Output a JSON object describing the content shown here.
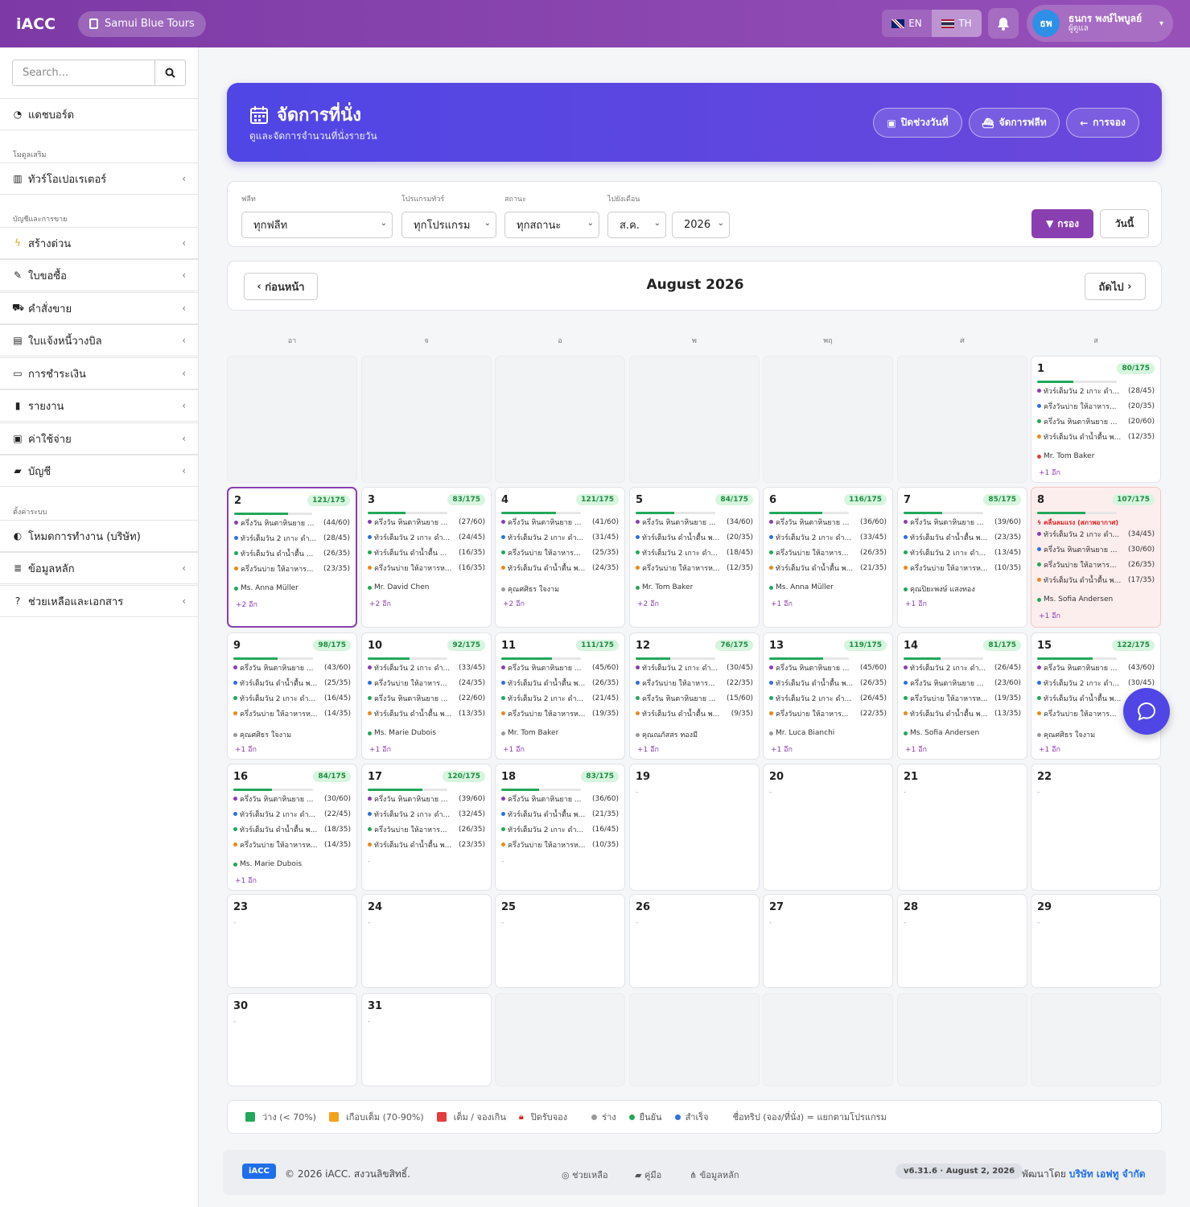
{
  "topbar": {
    "brand": "iACC",
    "company": "Samui Blue Tours",
    "lang_en": "EN",
    "lang_th": "TH",
    "user_initials": "ธพ",
    "user_name": "ธนกร พงษ์ไพบูลย์",
    "user_role": "ผู้ดูแล"
  },
  "sidebar": {
    "search_placeholder": "Search...",
    "dashboard": "แดชบอร์ด",
    "sect_modules": "โมดูลเสริม",
    "tour_operator": "ทัวร์โอเปอเรเตอร์",
    "sect_sales": "บัญชีและการขาย",
    "quick_create": "สร้างด่วน",
    "po": "ใบขอซื้อ",
    "sales_order": "คำสั่งขาย",
    "invoice": "ใบแจ้งหนี้วางบิล",
    "payment": "การชำระเงิน",
    "report": "รายงาน",
    "expense": "ค่าใช้จ่าย",
    "account": "บัญชี",
    "sect_settings": "ตั้งค่าระบบ",
    "work_mode": "โหมดการทำงาน (บริษัท)",
    "master_data": "ข้อมูลหลัก",
    "help": "ช่วยเหลือและเอกสาร"
  },
  "hero": {
    "title": "จัดการที่นั่ง",
    "subtitle": "ดูและจัดการจำนวนที่นั่งรายวัน",
    "btn_close": "ปิดช่วงวันที่",
    "btn_fleet": "จัดการฟลีท",
    "btn_back": "การจอง"
  },
  "filters": {
    "fleet_label": "ฟลีท",
    "fleet_value": "ทุกฟลีท",
    "program_label": "โปรแกรมทัวร์",
    "program_value": "ทุกโปรแกรม",
    "status_label": "สถานะ",
    "status_value": "ทุกสถานะ",
    "month_label": "ไปยังเดือน",
    "month_value": "ส.ค.",
    "year_value": "2026",
    "filter_btn": "กรอง",
    "today_btn": "วันนี้"
  },
  "month": {
    "prev": "ก่อนหน้า",
    "title": "August 2026",
    "next": "ถัดไป"
  },
  "weekdays": [
    "อา",
    "จ",
    "อ",
    "พ",
    "พฤ",
    "ศ",
    "ส"
  ],
  "colors": {
    "purple": "#8a3fb0",
    "status_pending": "#8a3fb0",
    "status_confirmed": "#22a85a",
    "status_done": "#2f6fe0",
    "orange": "#e88a1a"
  },
  "days": [
    {
      "d": "1",
      "badge": "80/175",
      "pct": 0.457,
      "rows": [
        [
          "ทัวร์เต็มวัน 2 เกาะ ดำ...",
          "(28/45)",
          "#8a3fb0"
        ],
        [
          "ครึ่งวันบ่าย ให้อาหาร...",
          "(20/35)",
          "#2f6fe0"
        ],
        [
          "ครึ่งวัน หินตาหินยาย ...",
          "(20/60)",
          "#22a85a"
        ],
        [
          "ทัวร์เต็มวัน ดำน้ำตื้น พ...",
          "(12/35)",
          "#e88a1a"
        ]
      ],
      "guest": "Mr. Tom Baker",
      "gc": "#e04040",
      "more": "+1 อีก"
    },
    {
      "d": "2",
      "badge": "121/175",
      "pct": 0.691,
      "rows": [
        [
          "ครึ่งวัน หินตาหินยาย ...",
          "(44/60)",
          "#8a3fb0"
        ],
        [
          "ทัวร์เต็มวัน 2 เกาะ ดำ...",
          "(28/45)",
          "#2f6fe0"
        ],
        [
          "ทัวร์เต็มวัน ดำน้ำตื้น ...",
          "(26/35)",
          "#22a85a"
        ],
        [
          "ครึ่งวันบ่าย ให้อาหาร...",
          "(23/35)",
          "#e88a1a"
        ]
      ],
      "guest": "Ms. Anna Müller",
      "gc": "#22a85a",
      "more": "+2 อีก"
    },
    {
      "d": "3",
      "badge": "83/175",
      "pct": 0.474,
      "rows": [
        [
          "ครึ่งวัน หินตาหินยาย ...",
          "(27/60)",
          "#8a3fb0"
        ],
        [
          "ทัวร์เต็มวัน 2 เกาะ ดำ...",
          "(24/45)",
          "#2f6fe0"
        ],
        [
          "ทัวร์เต็มวัน ดำน้ำตื้น ...",
          "(16/35)",
          "#22a85a"
        ],
        [
          "ครึ่งวันบ่าย ให้อาหารห...",
          "(16/35)",
          "#e88a1a"
        ]
      ],
      "guest": "Mr. David Chen",
      "gc": "#22a85a",
      "more": "+2 อีก"
    },
    {
      "d": "4",
      "badge": "121/175",
      "pct": 0.691,
      "rows": [
        [
          "ครึ่งวัน หินตาหินยาย ...",
          "(41/60)",
          "#8a3fb0"
        ],
        [
          "ทัวร์เต็มวัน 2 เกาะ ดำ...",
          "(31/45)",
          "#2f6fe0"
        ],
        [
          "ครึ่งวันบ่าย ให้อาหาร...",
          "(25/35)",
          "#22a85a"
        ],
        [
          "ทัวร์เต็มวัน ดำน้ำตื้น พ...",
          "(24/35)",
          "#e88a1a"
        ]
      ],
      "guest": "คุณศศิธร ใจงาม",
      "gc": "#999999",
      "more": "+2 อีก"
    },
    {
      "d": "5",
      "badge": "84/175",
      "pct": 0.48,
      "rows": [
        [
          "ครึ่งวัน หินตาหินยาย ...",
          "(34/60)",
          "#8a3fb0"
        ],
        [
          "ทัวร์เต็มวัน ดำน้ำตื้น พ...",
          "(20/35)",
          "#2f6fe0"
        ],
        [
          "ทัวร์เต็มวัน 2 เกาะ ดำ...",
          "(18/45)",
          "#22a85a"
        ],
        [
          "ครึ่งวันบ่าย ให้อาหารห...",
          "(12/35)",
          "#e88a1a"
        ]
      ],
      "guest": "Mr. Tom Baker",
      "gc": "#22a85a",
      "more": "+2 อีก"
    },
    {
      "d": "6",
      "badge": "116/175",
      "pct": 0.663,
      "rows": [
        [
          "ครึ่งวัน หินตาหินยาย ...",
          "(36/60)",
          "#8a3fb0"
        ],
        [
          "ทัวร์เต็มวัน 2 เกาะ ดำ...",
          "(33/45)",
          "#2f6fe0"
        ],
        [
          "ครึ่งวันบ่าย ให้อาหาร...",
          "(26/35)",
          "#22a85a"
        ],
        [
          "ทัวร์เต็มวัน ดำน้ำตื้น พ...",
          "(21/35)",
          "#e88a1a"
        ]
      ],
      "guest": "Ms. Anna Müller",
      "gc": "#22a85a",
      "more": "+1 อีก"
    },
    {
      "d": "7",
      "badge": "85/175",
      "pct": 0.486,
      "rows": [
        [
          "ครึ่งวัน หินตาหินยาย ...",
          "(39/60)",
          "#8a3fb0"
        ],
        [
          "ทัวร์เต็มวัน ดำน้ำตื้น พ...",
          "(23/35)",
          "#2f6fe0"
        ],
        [
          "ทัวร์เต็มวัน 2 เกาะ ดำ...",
          "(13/45)",
          "#22a85a"
        ],
        [
          "ครึ่งวันบ่าย ให้อาหารห...",
          "(10/35)",
          "#e88a1a"
        ]
      ],
      "guest": "คุณปิยะพงษ์ แสงทอง",
      "gc": "#22a85a",
      "more": "+1 อีก"
    },
    {
      "d": "8",
      "badge": "107/175",
      "pct": 0.611,
      "warn": "คลื่นลมแรง (สภาพอากาศ)",
      "rows": [
        [
          "ทัวร์เต็มวัน 2 เกาะ ดำ...",
          "(34/45)",
          "#8a3fb0"
        ],
        [
          "ครึ่งวัน หินตาหินยาย ...",
          "(30/60)",
          "#2f6fe0"
        ],
        [
          "ครึ่งวันบ่าย ให้อาหาร...",
          "(26/35)",
          "#22a85a"
        ],
        [
          "ทัวร์เต็มวัน ดำน้ำตื้น พ...",
          "(17/35)",
          "#e88a1a"
        ]
      ],
      "guest": "Ms. Sofia Andersen",
      "gc": "#22a85a",
      "more": "+1 อีก"
    },
    {
      "d": "9",
      "badge": "98/175",
      "pct": 0.56,
      "rows": [
        [
          "ครึ่งวัน หินตาหินยาย ...",
          "(43/60)",
          "#8a3fb0"
        ],
        [
          "ทัวร์เต็มวัน ดำน้ำตื้น พ...",
          "(25/35)",
          "#2f6fe0"
        ],
        [
          "ทัวร์เต็มวัน 2 เกาะ ดำ...",
          "(16/45)",
          "#22a85a"
        ],
        [
          "ครึ่งวันบ่าย ให้อาหารห...",
          "(14/35)",
          "#e88a1a"
        ]
      ],
      "guest": "คุณศศิธร ใจงาม",
      "gc": "#999999",
      "more": "+1 อีก"
    },
    {
      "d": "10",
      "badge": "92/175",
      "pct": 0.526,
      "rows": [
        [
          "ทัวร์เต็มวัน 2 เกาะ ดำ...",
          "(33/45)",
          "#8a3fb0"
        ],
        [
          "ครึ่งวันบ่าย ให้อาหาร...",
          "(24/35)",
          "#2f6fe0"
        ],
        [
          "ครึ่งวัน หินตาหินยาย ...",
          "(22/60)",
          "#22a85a"
        ],
        [
          "ทัวร์เต็มวัน ดำน้ำตื้น พ...",
          "(13/35)",
          "#e88a1a"
        ]
      ],
      "guest": "Ms. Marie Dubois",
      "gc": "#22a85a",
      "more": "+1 อีก"
    },
    {
      "d": "11",
      "badge": "111/175",
      "pct": 0.634,
      "rows": [
        [
          "ครึ่งวัน หินตาหินยาย ...",
          "(45/60)",
          "#8a3fb0"
        ],
        [
          "ทัวร์เต็มวัน ดำน้ำตื้น พ...",
          "(26/35)",
          "#2f6fe0"
        ],
        [
          "ทัวร์เต็มวัน 2 เกาะ ดำ...",
          "(21/45)",
          "#22a85a"
        ],
        [
          "ครึ่งวันบ่าย ให้อาหารห...",
          "(19/35)",
          "#e88a1a"
        ]
      ],
      "guest": "Mr. Tom Baker",
      "gc": "#999999",
      "more": "+1 อีก"
    },
    {
      "d": "12",
      "badge": "76/175",
      "pct": 0.434,
      "rows": [
        [
          "ทัวร์เต็มวัน 2 เกาะ ดำ...",
          "(30/45)",
          "#8a3fb0"
        ],
        [
          "ครึ่งวันบ่าย ให้อาหาร...",
          "(22/35)",
          "#2f6fe0"
        ],
        [
          "ครึ่งวัน หินตาหินยาย ...",
          "(15/60)",
          "#22a85a"
        ],
        [
          "ทัวร์เต็มวัน ดำน้ำตื้น พ...",
          "(9/35)",
          "#e88a1a"
        ]
      ],
      "guest": "คุณณภัสสร ทองมี",
      "gc": "#999999",
      "more": "+1 อีก"
    },
    {
      "d": "13",
      "badge": "119/175",
      "pct": 0.68,
      "rows": [
        [
          "ครึ่งวัน หินตาหินยาย ...",
          "(45/60)",
          "#8a3fb0"
        ],
        [
          "ทัวร์เต็มวัน ดำน้ำตื้น พ...",
          "(26/35)",
          "#2f6fe0"
        ],
        [
          "ทัวร์เต็มวัน 2 เกาะ ดำ...",
          "(26/45)",
          "#22a85a"
        ],
        [
          "ครึ่งวันบ่าย ให้อาหาร...",
          "(22/35)",
          "#e88a1a"
        ]
      ],
      "guest": "Mr. Luca Bianchi",
      "gc": "#999999",
      "more": "+1 อีก"
    },
    {
      "d": "14",
      "badge": "81/175",
      "pct": 0.463,
      "rows": [
        [
          "ทัวร์เต็มวัน 2 เกาะ ดำ...",
          "(26/45)",
          "#8a3fb0"
        ],
        [
          "ครึ่งวัน หินตาหินยาย ...",
          "(23/60)",
          "#2f6fe0"
        ],
        [
          "ครึ่งวันบ่าย ให้อาหารห...",
          "(19/35)",
          "#22a85a"
        ],
        [
          "ทัวร์เต็มวัน ดำน้ำตื้น พ...",
          "(13/35)",
          "#e88a1a"
        ]
      ],
      "guest": "Ms. Sofia Andersen",
      "gc": "#22a85a",
      "more": "+1 อีก"
    },
    {
      "d": "15",
      "badge": "122/175",
      "pct": 0.697,
      "rows": [
        [
          "ครึ่งวัน หินตาหินยาย ...",
          "(43/60)",
          "#8a3fb0"
        ],
        [
          "ทัวร์เต็มวัน 2 เกาะ ดำ...",
          "(30/45)",
          "#2f6fe0"
        ],
        [
          "ทัวร์เต็มวัน ดำน้ำตื้น พ...",
          "",
          "#22a85a"
        ],
        [
          "ครึ่งวันบ่าย ให้อาหาร...",
          "",
          "#e88a1a"
        ]
      ],
      "guest": "คุณศศิธร ใจงาม",
      "gc": "#999999",
      "more": "+1 อีก"
    },
    {
      "d": "16",
      "badge": "84/175",
      "pct": 0.48,
      "rows": [
        [
          "ครึ่งวัน หินตาหินยาย ...",
          "(30/60)",
          "#8a3fb0"
        ],
        [
          "ทัวร์เต็มวัน 2 เกาะ ดำ...",
          "(22/45)",
          "#2f6fe0"
        ],
        [
          "ทัวร์เต็มวัน ดำน้ำตื้น พ...",
          "(18/35)",
          "#22a85a"
        ],
        [
          "ครึ่งวันบ่าย ให้อาหารห...",
          "(14/35)",
          "#e88a1a"
        ]
      ],
      "guest": "Ms. Marie Dubois",
      "gc": "#22a85a",
      "more": "+1 อีก"
    },
    {
      "d": "17",
      "badge": "120/175",
      "pct": 0.686,
      "rows": [
        [
          "ครึ่งวัน หินตาหินยาย ...",
          "(39/60)",
          "#8a3fb0"
        ],
        [
          "ทัวร์เต็มวัน 2 เกาะ ดำ...",
          "(32/45)",
          "#2f6fe0"
        ],
        [
          "ครึ่งวันบ่าย ให้อาหาร...",
          "(26/35)",
          "#22a85a"
        ],
        [
          "ทัวร์เต็มวัน ดำน้ำตื้น พ...",
          "(23/35)",
          "#e88a1a"
        ]
      ],
      "dash": "-"
    },
    {
      "d": "18",
      "badge": "83/175",
      "pct": 0.474,
      "rows": [
        [
          "ครึ่งวัน หินตาหินยาย ...",
          "(36/60)",
          "#8a3fb0"
        ],
        [
          "ทัวร์เต็มวัน ดำน้ำตื้น พ...",
          "(21/35)",
          "#2f6fe0"
        ],
        [
          "ทัวร์เต็มวัน 2 เกาะ ดำ...",
          "(16/45)",
          "#22a85a"
        ],
        [
          "ครึ่งวันบ่าย ให้อาหารห...",
          "(10/35)",
          "#e88a1a"
        ]
      ],
      "dash": "-"
    },
    {
      "d": "19",
      "dash": "-"
    },
    {
      "d": "20",
      "dash": "-"
    },
    {
      "d": "21",
      "dash": "-"
    },
    {
      "d": "22",
      "dash": "-"
    },
    {
      "d": "23",
      "dash": "-"
    },
    {
      "d": "24",
      "dash": "-"
    },
    {
      "d": "25",
      "dash": "-"
    },
    {
      "d": "26",
      "dash": "-"
    },
    {
      "d": "27",
      "dash": "-"
    },
    {
      "d": "28",
      "dash": "-"
    },
    {
      "d": "29",
      "dash": "-"
    },
    {
      "d": "30",
      "dash": "-"
    },
    {
      "d": "31",
      "dash": "-"
    }
  ],
  "legend": {
    "available": "ว่าง (< 70%)",
    "almost": "เกือบเต็ม (70-90%)",
    "full": "เต็ม / จองเกิน",
    "closed": "ปิดรับจอง",
    "s_pending": "ร่าง",
    "s_confirmed": "ยืนยัน",
    "s_done": "สำเร็จ",
    "note": "ชื่อทริป (จอง/ที่นั่ง) = แยกตามโปรแกรม"
  },
  "footer": {
    "logo": "iACC",
    "copyright": "© 2026 iACC. สงวนลิขสิทธิ์.",
    "help": "ช่วยเหลือ",
    "manual": "คู่มือ",
    "master": "ข้อมูลหลัก",
    "version": "v6.31.6 · August 2, 2026",
    "dev_prefix": "พัฒนาโดย",
    "dev_name": "บริษัท เอฟทู จำกัด"
  }
}
